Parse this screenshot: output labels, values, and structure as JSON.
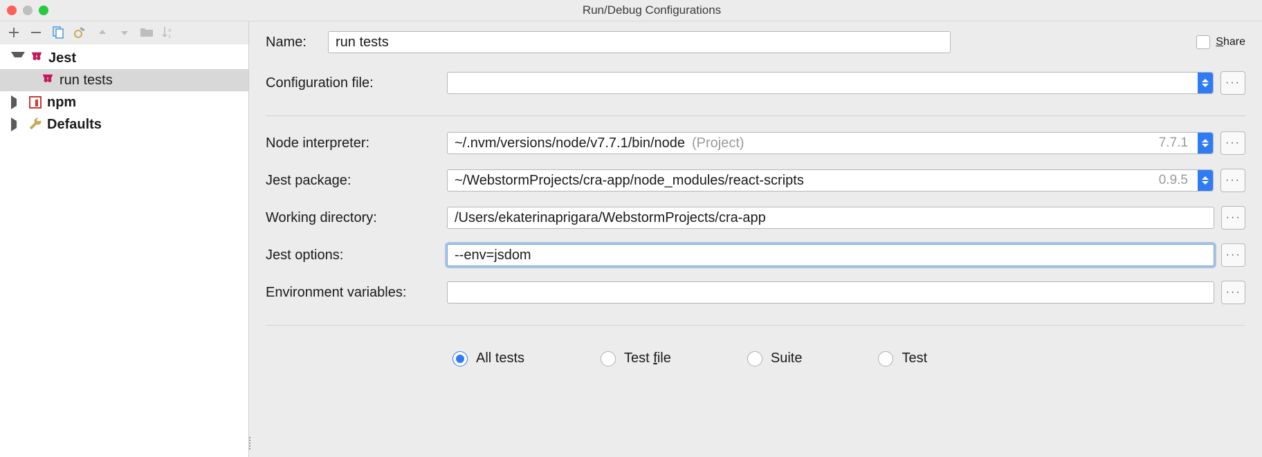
{
  "window": {
    "title": "Run/Debug Configurations"
  },
  "tree": {
    "items": [
      {
        "label": "Jest",
        "icon": "jest-icon",
        "expanded": true,
        "children": [
          {
            "label": "run tests",
            "icon": "jest-icon",
            "selected": true
          }
        ]
      },
      {
        "label": "npm",
        "icon": "npm-icon",
        "expanded": false
      },
      {
        "label": "Defaults",
        "icon": "wrench-icon",
        "expanded": false
      }
    ]
  },
  "form": {
    "name_label": "Name:",
    "name_value": "run tests",
    "share_label": "Share",
    "config_file_label": "Configuration file:",
    "config_file_value": "",
    "node_interp_label": "Node interpreter:",
    "node_interp_value": "~/.nvm/versions/node/v7.7.1/bin/node",
    "node_interp_hint": "(Project)",
    "node_interp_version": "7.7.1",
    "jest_pkg_label": "Jest package:",
    "jest_pkg_value": "~/WebstormProjects/cra-app/node_modules/react-scripts",
    "jest_pkg_version": "0.9.5",
    "work_dir_label": "Working directory:",
    "work_dir_value": "/Users/ekaterinaprigara/WebstormProjects/cra-app",
    "jest_opts_label": "Jest options:",
    "jest_opts_value": "--env=jsdom",
    "env_vars_label": "Environment variables:",
    "env_vars_value": "",
    "radios": {
      "all": "All tests",
      "file": "Test file",
      "suite": "Suite",
      "test": "Test",
      "selected": "all"
    }
  }
}
